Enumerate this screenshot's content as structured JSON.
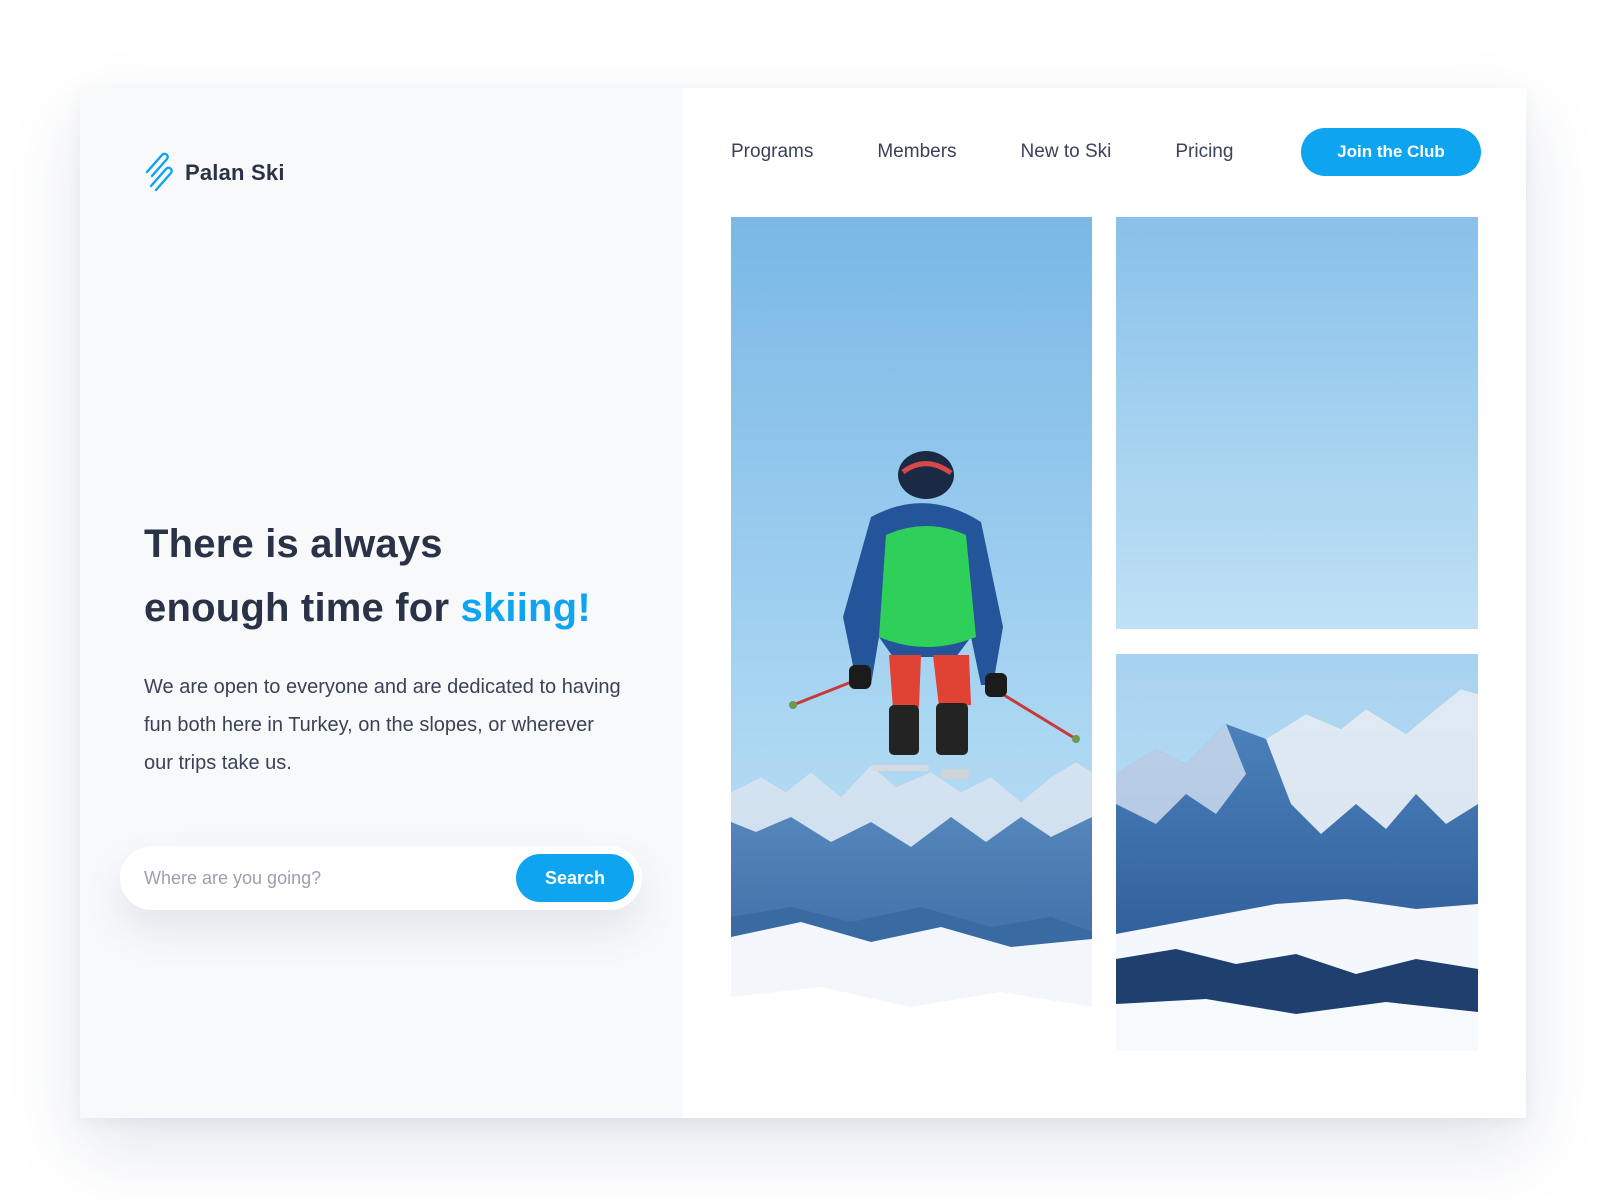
{
  "brand": {
    "name": "Palan Ski",
    "logo_icon": "double-slash-skis-icon",
    "accent_color": "#0ea4f0",
    "text_color": "#2a3247"
  },
  "nav": {
    "links": [
      {
        "label": "Programs"
      },
      {
        "label": "Members"
      },
      {
        "label": "New to Ski"
      },
      {
        "label": "Pricing"
      }
    ],
    "cta_label": "Join the Club"
  },
  "hero": {
    "headline_line1": "There is always",
    "headline_line2_prefix": "enough time for ",
    "headline_accent": "skiing!",
    "description": "We are open to everyone and are dedicated to having fun both here in Turkey, on the slopes, or wherever our trips take us."
  },
  "search": {
    "placeholder": "Where are you going?",
    "value": "",
    "button_label": "Search"
  },
  "gallery": {
    "images": [
      {
        "subject": "skier-jumping-over-mountains-photo"
      },
      {
        "subject": "clear-blue-sky-photo"
      },
      {
        "subject": "snowy-mountain-range-photo"
      }
    ]
  }
}
